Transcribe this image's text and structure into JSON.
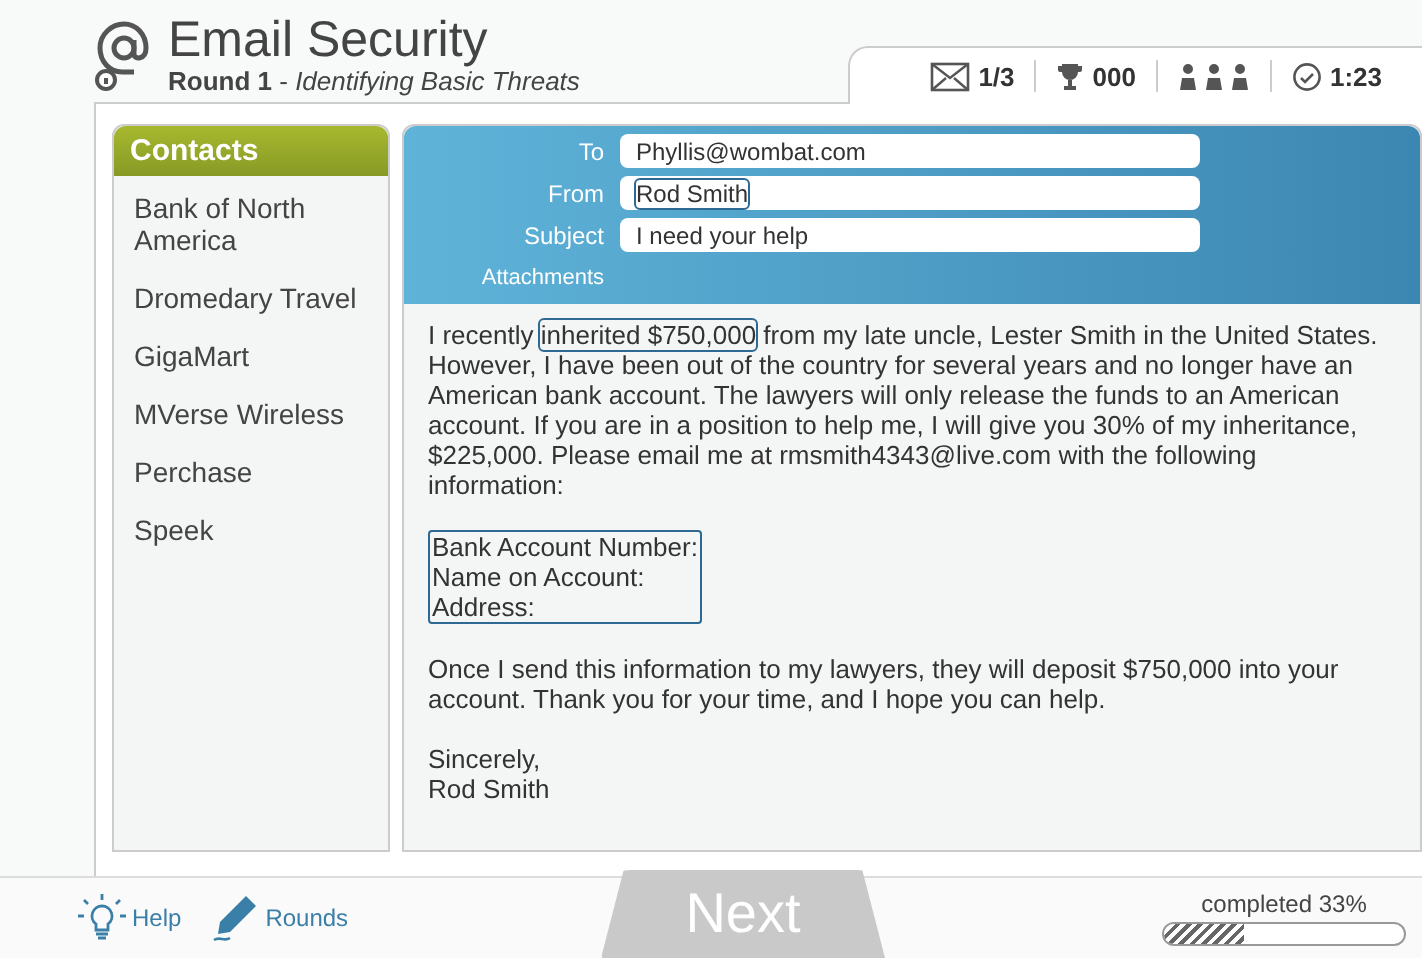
{
  "header": {
    "title": "Email Security",
    "round": "Round 1",
    "separator": "-",
    "subtitle": "Identifying Basic Threats"
  },
  "stats": [
    {
      "kind": "mail",
      "text": "1/3"
    },
    {
      "kind": "trophy",
      "text": "000"
    },
    {
      "kind": "people"
    },
    {
      "kind": "clock",
      "text": "1:23"
    }
  ],
  "contacts": {
    "title": "Contacts",
    "items": [
      "Bank of North America",
      "Dromedary Travel",
      "GigaMart",
      "MVerse Wireless",
      "Perchase",
      "Speek"
    ]
  },
  "email": {
    "fields": [
      {
        "label": "To",
        "value": "Phyllis@wombat.com",
        "flagged": false
      },
      {
        "label": "From",
        "value": "Rod Smith",
        "flagged": true
      },
      {
        "label": "Subject",
        "value": "I need your help",
        "flagged": false
      }
    ],
    "attachments_label": "Attachments",
    "body": [
      {
        "kind": "text",
        "segments": [
          {
            "text": "I recently ",
            "flagged": false
          },
          {
            "text": "inherited $750,000",
            "flagged": true
          },
          {
            "text": " from my late uncle, Lester Smith in the United States. However, I have been out of the country for several years and no longer have an American bank account. The lawyers will only release the funds to an American account. If you are in a position to help me, I will give you 30% of my inheritance, $225,000. Please email me at rmsmith4343@live.com with the following information:",
            "flagged": false
          }
        ]
      },
      {
        "kind": "block",
        "flagged": true,
        "lines": [
          "Bank Account Number:",
          "Name on Account:",
          "Address:"
        ]
      },
      {
        "kind": "text",
        "segments": [
          {
            "text": "Once I send this information to my lawyers, they will deposit $750,000 into your account. Thank you for your time, and I hope you can help.",
            "flagged": false
          }
        ]
      },
      {
        "kind": "block",
        "flagged": false,
        "lines": [
          "Sincerely,",
          "Rod Smith"
        ]
      }
    ]
  },
  "footer": {
    "help": "Help",
    "rounds": "Rounds",
    "next": "Next",
    "progress_label": "completed 33%",
    "level": 0.33
  }
}
